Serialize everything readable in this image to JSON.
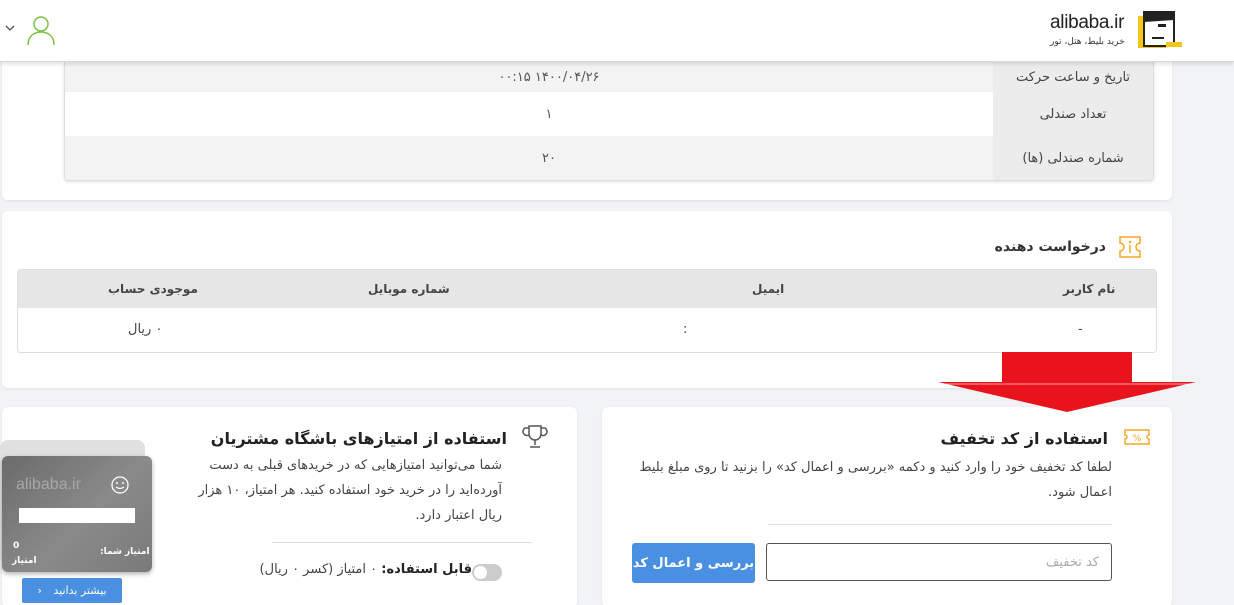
{
  "header": {
    "logo_text": "alibaba.ir",
    "logo_subtitle": "خرید بلیط، هتل، تور"
  },
  "trip_details": {
    "rows": [
      {
        "label": "تاریخ و ساعت حرکت",
        "value": "۱۴۰۰/۰۴/۲۶ ۰۰:۱۵"
      },
      {
        "label": "تعداد صندلی",
        "value": "۱"
      },
      {
        "label": "شماره صندلی (ها)",
        "value": "۲۰"
      }
    ]
  },
  "requester": {
    "title": "درخواست دهنده",
    "columns": [
      "نام کاربر",
      "ایمیل",
      "شماره موبایل",
      "موجودی حساب"
    ],
    "row": {
      "username": "-",
      "email": ":",
      "mobile": "",
      "balance": "۰ ریال"
    }
  },
  "discount": {
    "title": "استفاده از کد تخفیف",
    "description": "لطفا کد تخفیف خود را وارد کنید و دکمه «بررسی و اعمال کد» را بزنید تا روی مبلغ بلیط اعمال شود.",
    "input_placeholder": "کد تخفیف",
    "button_label": "بررسی و اعمال کد"
  },
  "club": {
    "title": "استفاده از امتیازهای باشگاه مشتریان",
    "description": "شما می‌توانید امتیازهایی که در خریدهای قبلی به دست آورده‌اید را در خرید خود استفاده کنید. هر امتیاز، ۱۰ هزار ریال اعتبار دارد.",
    "usable_label": "قابل استفاده:",
    "usable_value": "۰ امتیاز (کسر ۰ ریال)",
    "card": {
      "logo": "alibaba.ir",
      "score_label": "امتیاز شما:",
      "score_value": "0",
      "score_unit": "امتیاز"
    },
    "more_button": "بیشتر بدانید"
  },
  "colors": {
    "primary_button": "#4a90e2",
    "accent_icon": "#f5a623",
    "arrow": "#e8131b",
    "user_icon": "#7ac143"
  }
}
